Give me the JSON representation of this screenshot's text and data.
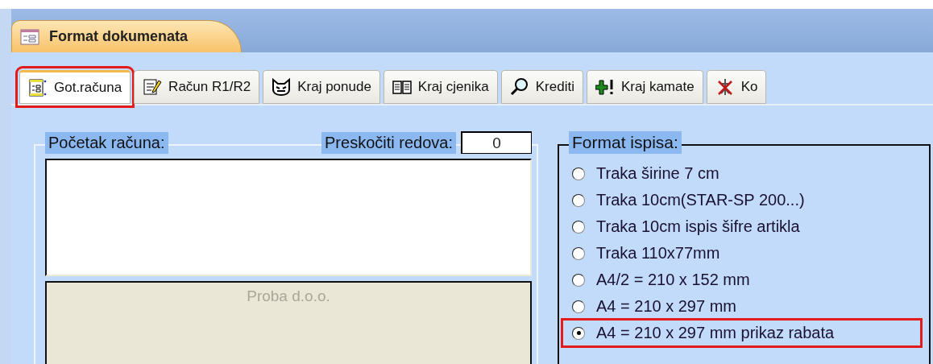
{
  "document_tab": {
    "title": "Format dokumenata"
  },
  "tabs": [
    {
      "label": "Got.računa",
      "kind": "form",
      "selected": true,
      "highlighted": true
    },
    {
      "label": "Račun R1/R2",
      "kind": "note",
      "selected": false,
      "highlighted": false
    },
    {
      "label": "Kraj ponude",
      "kind": "mask",
      "selected": false,
      "highlighted": false
    },
    {
      "label": "Kraj cjenika",
      "kind": "book",
      "selected": false,
      "highlighted": false
    },
    {
      "label": "Krediti",
      "kind": "search",
      "selected": false,
      "highlighted": false
    },
    {
      "label": "Kraj kamate",
      "kind": "plus",
      "selected": false,
      "highlighted": false
    },
    {
      "label": "Ko",
      "kind": "cross",
      "selected": false,
      "highlighted": false
    }
  ],
  "invoice_start": {
    "legend": "Početak računa:",
    "skip_rows_label": "Preskočiti redova:",
    "skip_rows_value": "0",
    "preview_text": "Proba d.o.o."
  },
  "print_format": {
    "legend": "Format ispisa:",
    "options": [
      {
        "label": "Traka širine 7 cm",
        "selected": false,
        "highlighted": false
      },
      {
        "label": "Traka 10cm(STAR-SP 200...)",
        "selected": false,
        "highlighted": false
      },
      {
        "label": "Traka 10cm ispis šifre artikla",
        "selected": false,
        "highlighted": false
      },
      {
        "label": "Traka 110x77mm",
        "selected": false,
        "highlighted": false
      },
      {
        "label": "A4/2 = 210 x 152 mm",
        "selected": false,
        "highlighted": false
      },
      {
        "label": "A4 = 210 x 297 mm",
        "selected": false,
        "highlighted": false
      },
      {
        "label": "A4 = 210 x 297 mm prikaz rabata",
        "selected": true,
        "highlighted": true
      }
    ]
  }
}
